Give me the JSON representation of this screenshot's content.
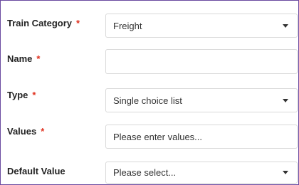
{
  "form": {
    "fields": [
      {
        "label": "Train Category",
        "required": "*",
        "type": "select",
        "value": "Freight"
      },
      {
        "label": "Name",
        "required": "*",
        "type": "text",
        "value": ""
      },
      {
        "label": "Type",
        "required": "*",
        "type": "select",
        "value": "Single choice list"
      },
      {
        "label": "Values",
        "required": "*",
        "type": "text",
        "value": "Please enter values..."
      },
      {
        "label": "Default Value",
        "required": "",
        "type": "select",
        "value": "Please select..."
      }
    ]
  },
  "colors": {
    "frame_border": "#6a4aa0",
    "required_star": "#e0301e",
    "field_border": "#d9d9d9"
  },
  "icons": {
    "dropdown": "chevron-down-icon"
  }
}
